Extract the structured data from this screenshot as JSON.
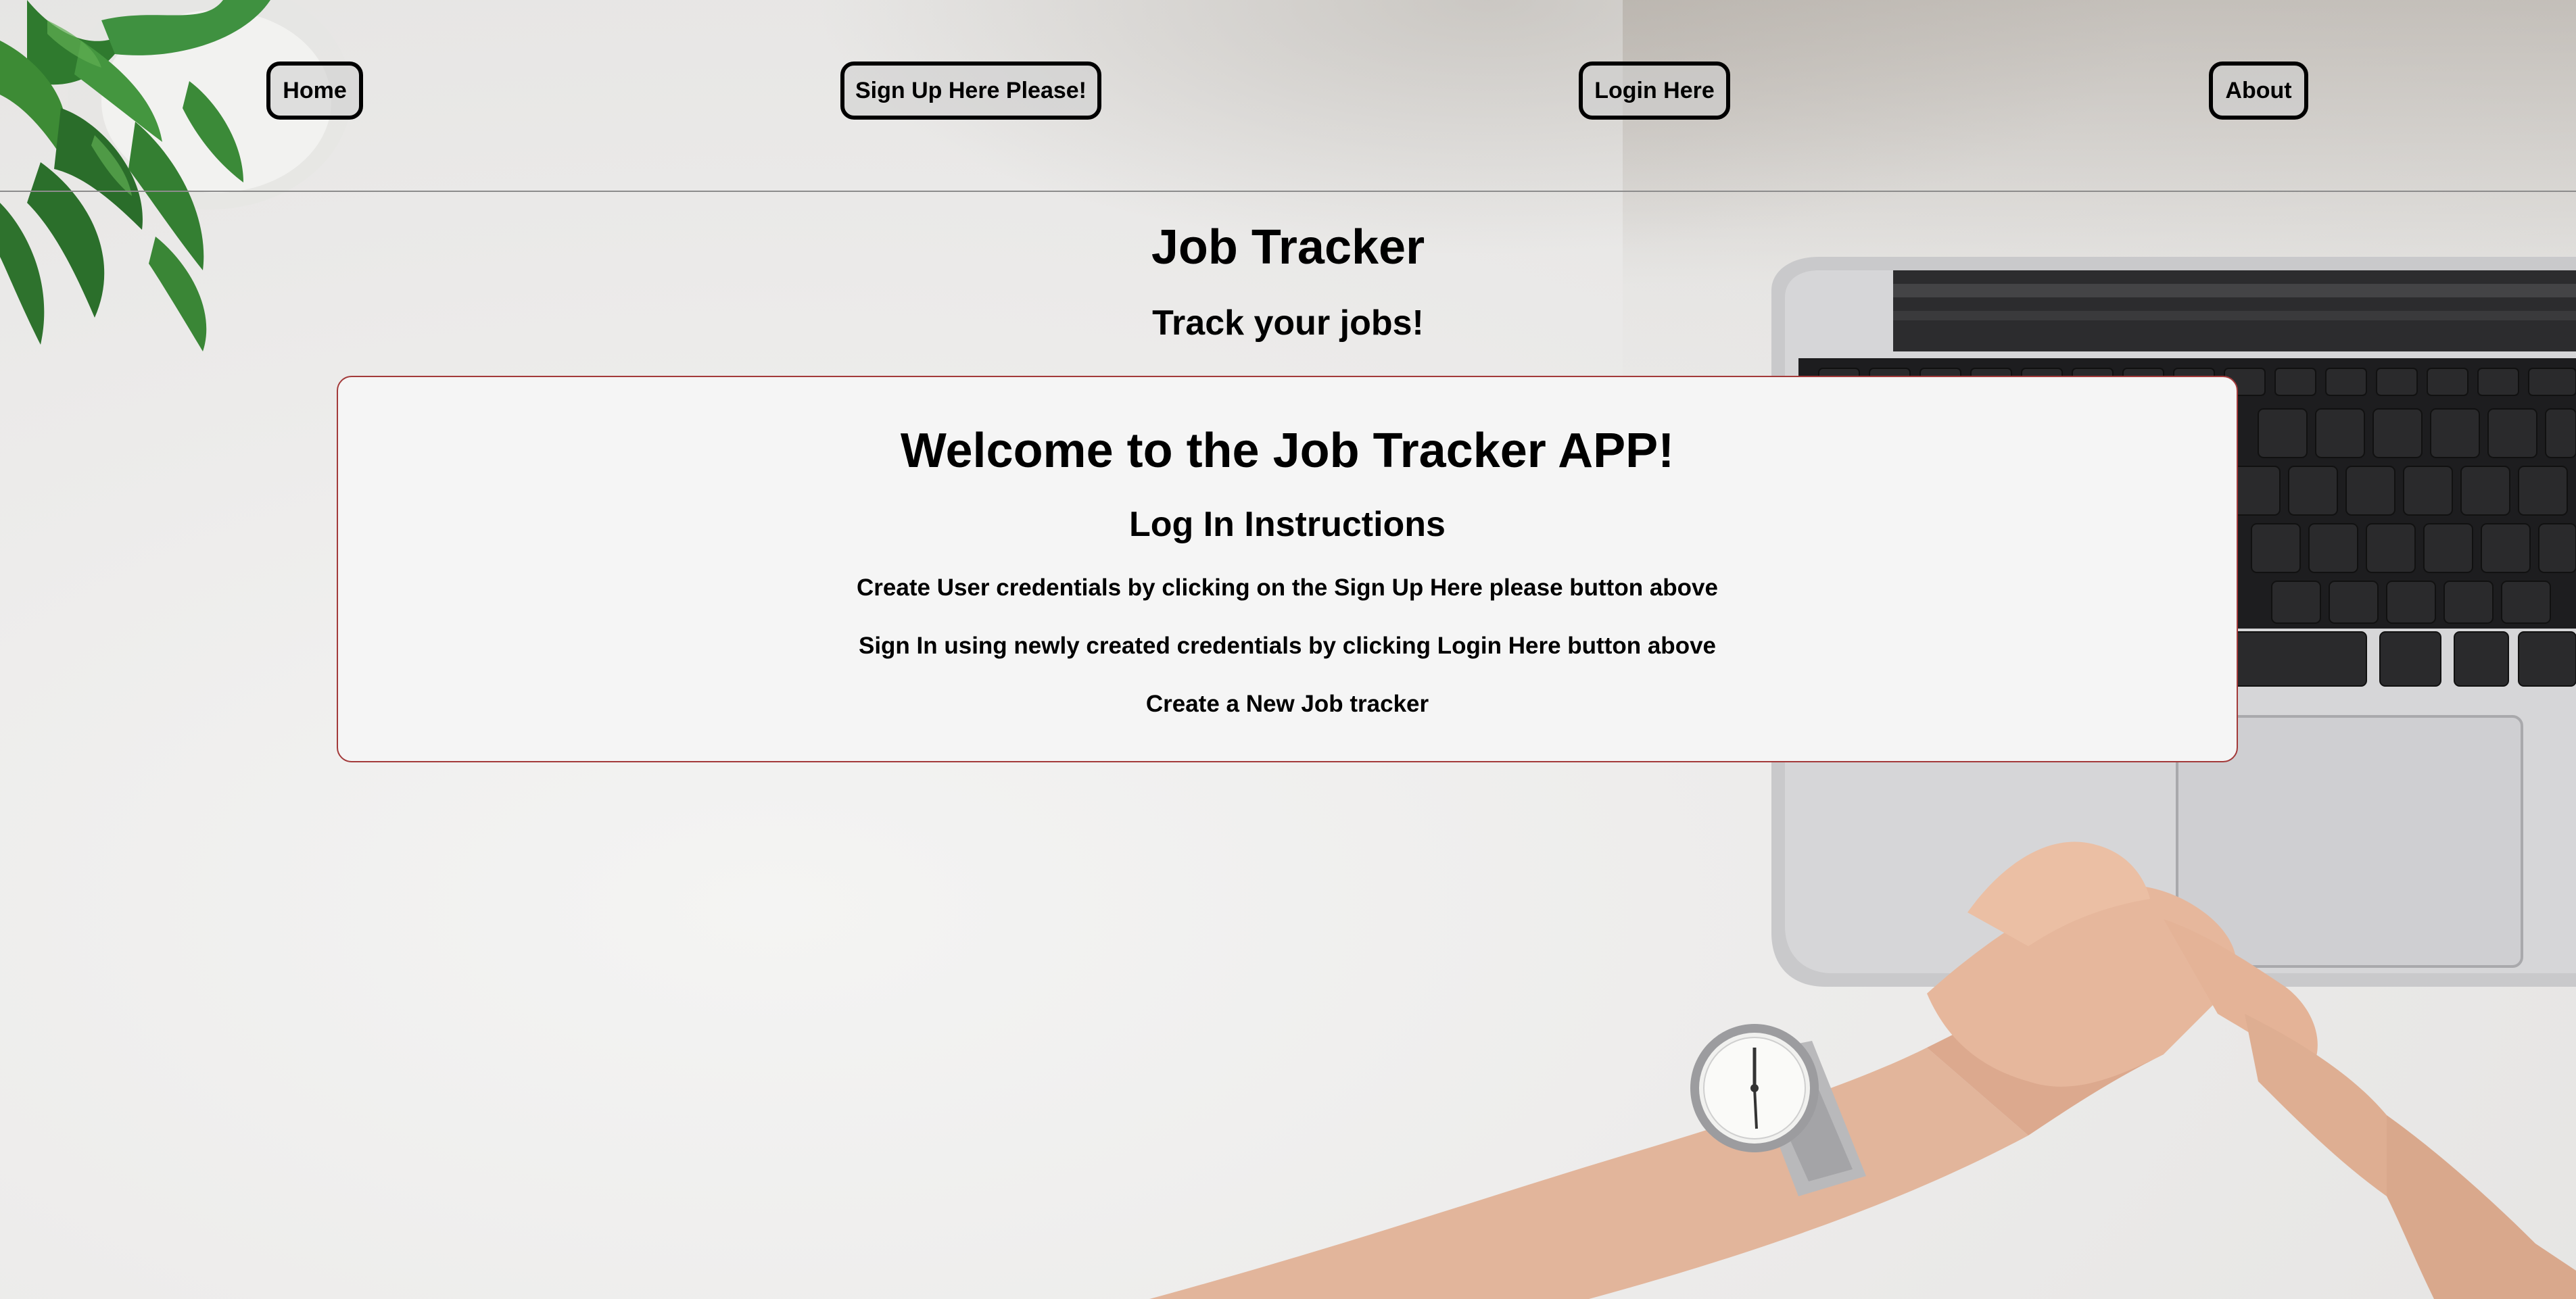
{
  "nav": {
    "home_label": "Home",
    "signup_label": "Sign Up Here Please!",
    "login_label": "Login Here",
    "about_label": "About"
  },
  "header": {
    "title": "Job Tracker",
    "subtitle": "Track your jobs!"
  },
  "welcome_card": {
    "title": "Welcome to the Job Tracker APP!",
    "subtitle": "Log In Instructions",
    "instructions": [
      "Create User credentials by clicking on the Sign Up Here please button above",
      "Sign In using newly created credentials by clicking Login Here button above",
      "Create a New Job tracker"
    ]
  },
  "colors": {
    "card_border": "#a33a3a",
    "card_background": "#f5f5f5",
    "button_border": "#000000",
    "divider": "#8c8c8c"
  },
  "background_image": {
    "icons": [
      "plant-icon",
      "laptop-icon",
      "wristwatch-icon"
    ]
  }
}
